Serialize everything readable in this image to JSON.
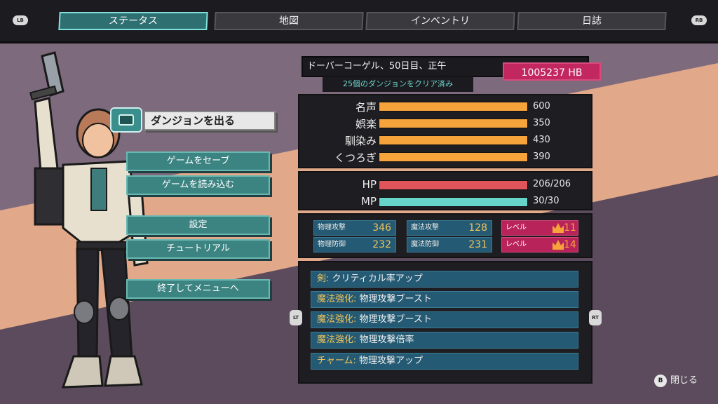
{
  "nav": {
    "lb": "LB",
    "rb": "RB",
    "tabs": [
      {
        "label": "ステータス",
        "active": true
      },
      {
        "label": "地図",
        "active": false
      },
      {
        "label": "インベントリ",
        "active": false
      },
      {
        "label": "日誌",
        "active": false
      }
    ]
  },
  "menu": {
    "exit_dungeon": "ダンジョンを出る",
    "save_game": "ゲームをセーブ",
    "load_game": "ゲームを読み込む",
    "settings": "設定",
    "tutorial": "チュートリアル",
    "quit_to_menu": "終了してメニューへ"
  },
  "header": {
    "day": "ドーバーコーゲル、50日目、正午",
    "dungeons_cleared": "25個のダンジョンをクリア済み",
    "hb": "1005237 HB"
  },
  "social_stats": [
    {
      "label": "名声",
      "value": "600"
    },
    {
      "label": "娯楽",
      "value": "350"
    },
    {
      "label": "馴染み",
      "value": "430"
    },
    {
      "label": "くつろぎ",
      "value": "390"
    }
  ],
  "vitals": {
    "hp_label": "HP",
    "hp_value": "206/206",
    "hp_fraction": 1.0,
    "mp_label": "MP",
    "mp_value": "30/30",
    "mp_fraction": 1.0
  },
  "combat": {
    "phys_atk_label": "物理攻撃",
    "phys_atk": "346",
    "phys_def_label": "物理防御",
    "phys_def": "232",
    "mag_atk_label": "魔法攻撃",
    "mag_atk": "128",
    "mag_def_label": "魔法防御",
    "mag_def": "231",
    "level_label": "レベル",
    "level_1": "11",
    "level_2": "14"
  },
  "skills": [
    {
      "type": "剣:",
      "text": " クリティカル率アップ"
    },
    {
      "type": "魔法強化:",
      "text": " 物理攻撃ブースト"
    },
    {
      "type": "魔法強化:",
      "text": " 物理攻撃ブースト"
    },
    {
      "type": "魔法強化:",
      "text": " 物理攻撃倍率"
    },
    {
      "type": "チャーム:",
      "text": " 物理攻撃アップ"
    }
  ],
  "triggers": {
    "lt": "LT",
    "rt": "RT"
  },
  "close": {
    "button": "B",
    "label": "閉じる"
  },
  "colors": {
    "accent_teal": "#2e6f72",
    "social_bar": "#f5a33a",
    "hp_bar": "#e0555b",
    "mp_bar": "#68d4c9",
    "hb_badge": "#c2275f",
    "level_badge": "#b8245a"
  }
}
